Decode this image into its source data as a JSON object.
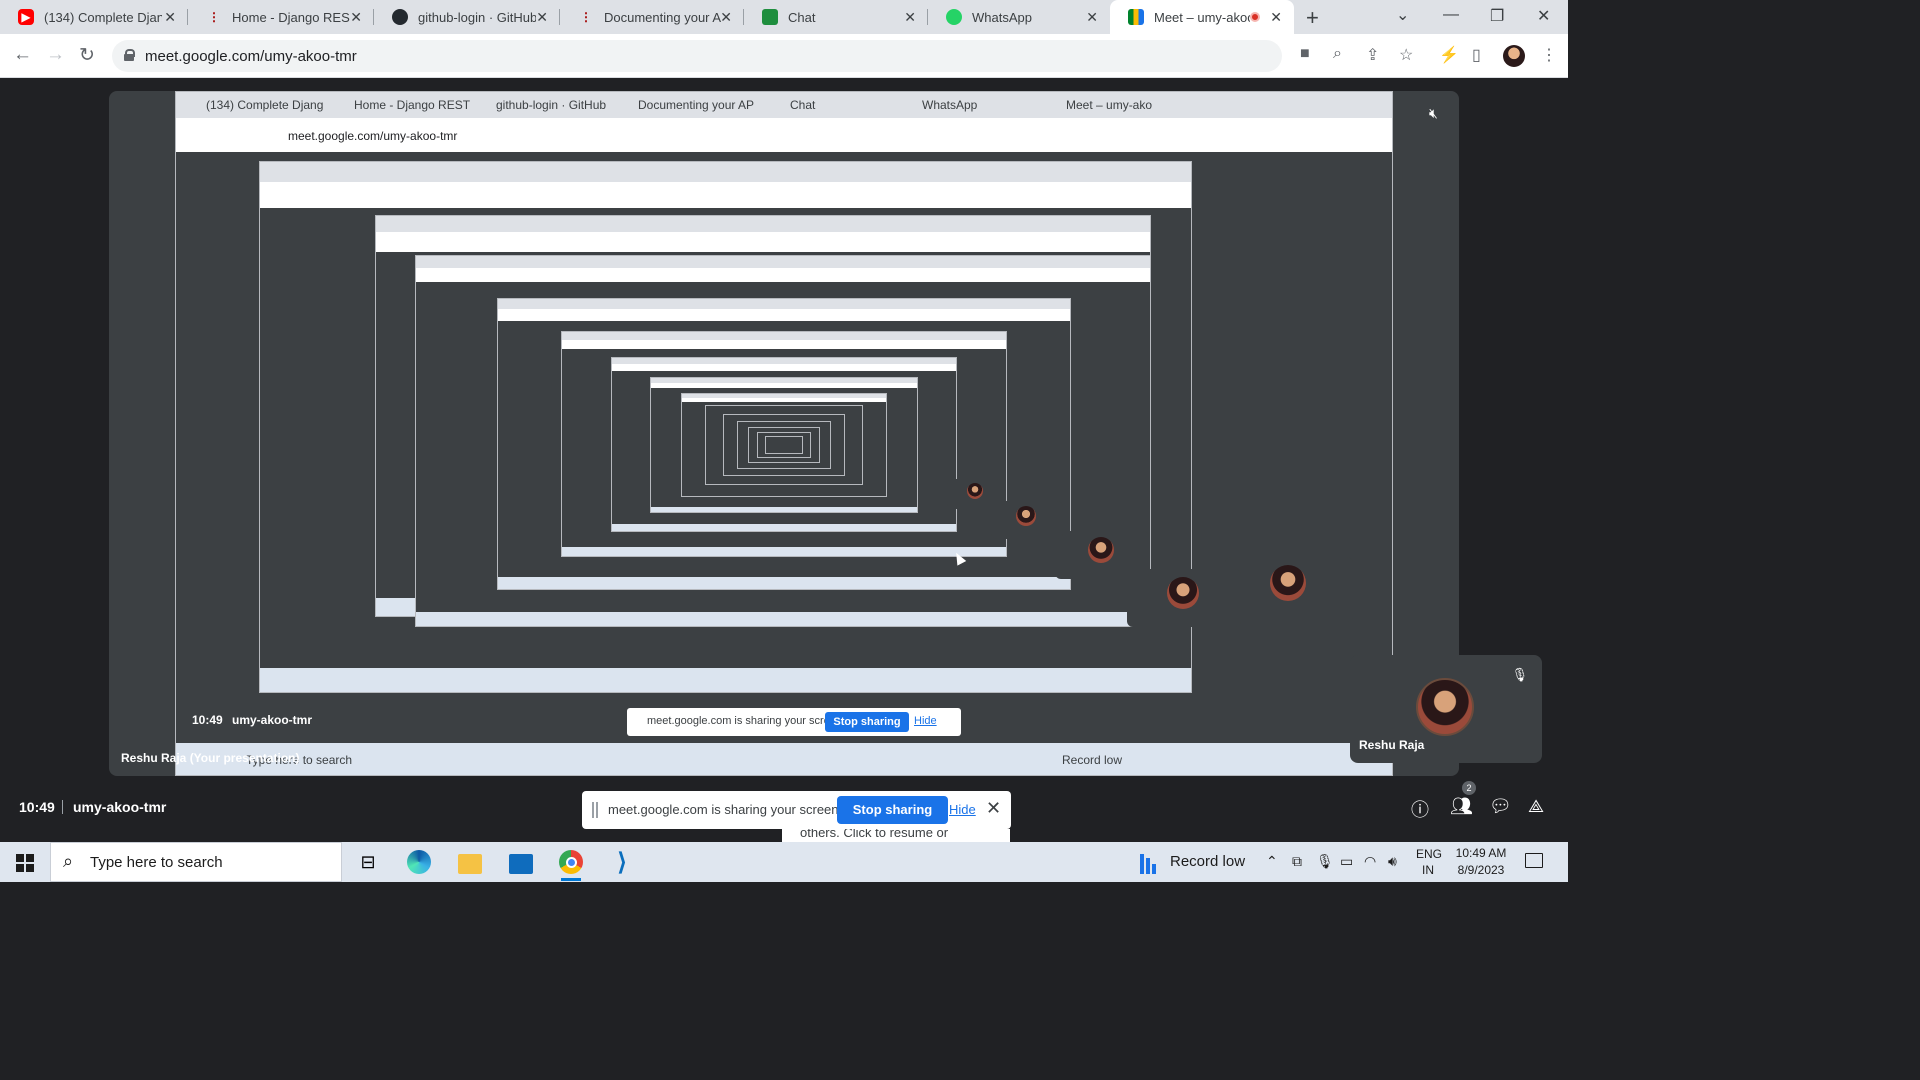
{
  "browser": {
    "tabs": [
      {
        "title": "(134) Complete Djang",
        "icon": "youtube-icon"
      },
      {
        "title": "Home - Django REST",
        "icon": "django-rest-icon"
      },
      {
        "title": "github-login · GitHub",
        "icon": "github-icon"
      },
      {
        "title": "Documenting your AP",
        "icon": "django-rest-icon"
      },
      {
        "title": "Chat",
        "icon": "google-chat-icon"
      },
      {
        "title": "WhatsApp",
        "icon": "whatsapp-icon"
      },
      {
        "title": "Meet – umy-akoo",
        "icon": "google-meet-icon",
        "active": true,
        "recording": true
      }
    ],
    "url": "meet.google.com/umy-akoo-tmr"
  },
  "meet": {
    "time": "10:49",
    "meeting_code": "umy-akoo-tmr",
    "participant_count": "2",
    "self_tile": {
      "name": "Reshu Raja",
      "muted": true
    },
    "presenter_label": "Reshu Raja (Your presentation)",
    "share_notice": {
      "text": "meet.google.com is sharing your screen.",
      "stop_label": "Stop sharing",
      "hide_label": "Hide",
      "resume_text": "others. Click to resume or"
    },
    "nested_tab_titles": [
      "(134) Complete Djang",
      "Home - Django REST",
      "github-login · GitHub",
      "Documenting your AP",
      "Chat",
      "WhatsApp",
      "Meet – umy-ako"
    ]
  },
  "taskbar": {
    "search_placeholder": "Type here to search",
    "apps": [
      "task-view-icon",
      "edge-icon",
      "file-explorer-icon",
      "mail-icon",
      "chrome-icon",
      "vscode-icon"
    ],
    "record_label": "Record low",
    "lang_top": "ENG",
    "lang_bottom": "IN",
    "clock_time": "10:49 AM",
    "clock_date": "8/9/2023"
  },
  "colors": {
    "meet_bg": "#202124",
    "tile_bg": "#3c4043",
    "accent": "#1a73e8",
    "recording": "#d93025"
  }
}
